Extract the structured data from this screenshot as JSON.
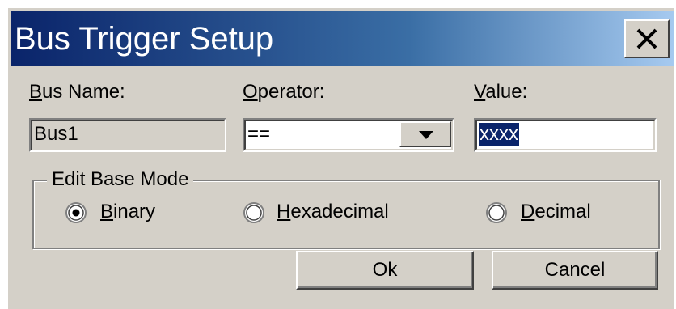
{
  "window": {
    "title": "Bus Trigger Setup",
    "close_glyph": "X"
  },
  "fields": {
    "bus_name_label": "Bus Name:",
    "bus_name_value": "Bus1",
    "operator_label": "Operator:",
    "operator_value": "==",
    "value_label": "Value:",
    "value_value": "xxxx"
  },
  "edit_base_mode": {
    "title": "Edit Base Mode",
    "options": [
      {
        "label": "Binary",
        "selected": true
      },
      {
        "label": "Hexadecimal",
        "selected": false
      },
      {
        "label": "Decimal",
        "selected": false
      }
    ]
  },
  "buttons": {
    "ok": "Ok",
    "cancel": "Cancel"
  },
  "colors": {
    "title_start": "#0a246a",
    "title_end": "#a6caf0",
    "face": "#d4d0c8",
    "selection": "#0a246a"
  },
  "icons": {
    "close": "close-icon",
    "dropdown": "dropdown-arrow-icon",
    "radio": "radio-button-icon"
  }
}
